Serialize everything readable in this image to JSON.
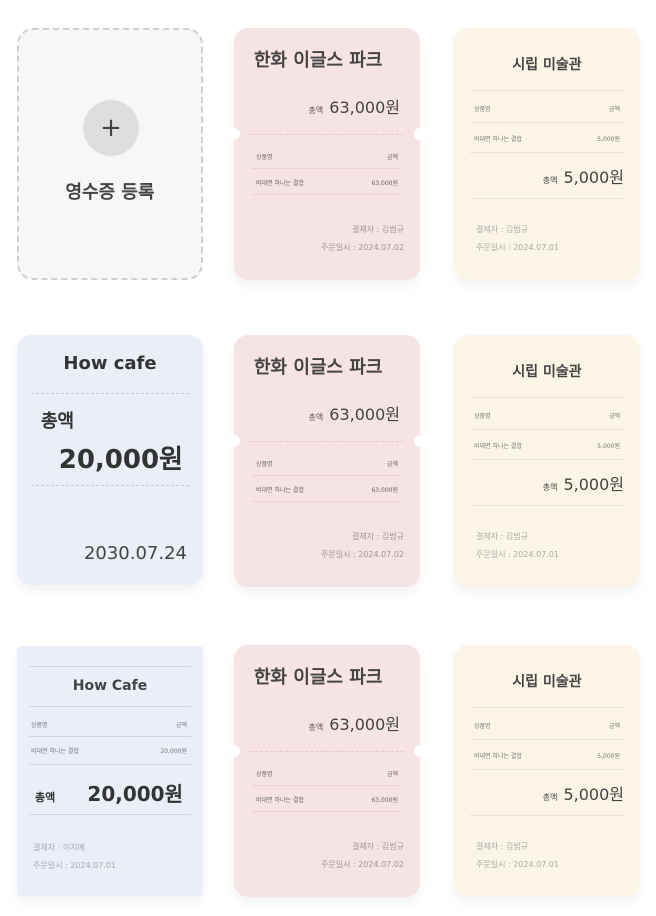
{
  "add_card": {
    "plus": "+",
    "label": "영수증 등록"
  },
  "pink_ticket": {
    "title": "한화 이글스 파크",
    "total_label": "총액",
    "total": "63,000원",
    "head_left": "상품명",
    "head_right": "금액",
    "item_name": "비대면 하나는 결합",
    "item_price": "63,000원",
    "payer": "결제자 : 김범규",
    "date": "주문일시 : 2024.07.02"
  },
  "cream_ticket": {
    "title": "시립 미술관",
    "head_left": "상품명",
    "head_right": "금액",
    "item_name": "비대면 하나는 결합",
    "item_price": "5,000원",
    "total_label": "총액",
    "total": "5,000원",
    "payer": "결제자 : 김범규",
    "date": "주문일시 : 2024.07.01"
  },
  "blue_card": {
    "title": "How cafe",
    "total_label": "총액",
    "total": "20,000원",
    "date": "2030.07.24"
  },
  "blue_receipt": {
    "title": "How Cafe",
    "head_left": "상품명",
    "head_right": "금액",
    "item_name": "비대면 하나는 결합",
    "item_price": "20,000원",
    "total_label": "총액",
    "total": "20,000원",
    "payer": "결제자 : 이지예",
    "date": "주문일시 : 2024.07.01"
  },
  "colors": {
    "pink": "#f6e3e3",
    "cream": "#faf5e6",
    "blue": "#e9eef7",
    "add_bg": "#f7f7f7"
  }
}
